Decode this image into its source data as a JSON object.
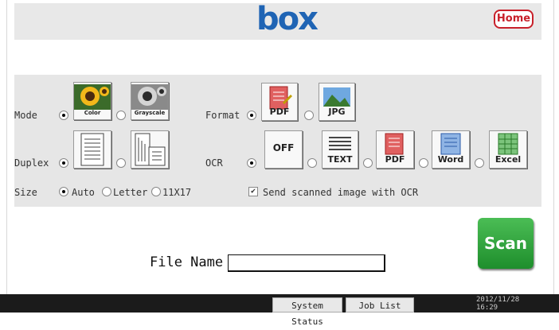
{
  "header": {
    "logo_text": "box",
    "home_label": "Home"
  },
  "mode": {
    "label": "Mode",
    "options": [
      {
        "caption": "Color",
        "selected": true
      },
      {
        "caption": "Grayscale",
        "selected": false
      }
    ]
  },
  "format": {
    "label": "Format",
    "options": [
      {
        "caption": "PDF",
        "selected": true
      },
      {
        "caption": "JPG",
        "selected": false
      }
    ]
  },
  "duplex": {
    "label": "Duplex",
    "options": [
      {
        "icon": "single-sided-page-icon",
        "selected": true
      },
      {
        "icon": "double-sided-pages-icon",
        "selected": false
      }
    ]
  },
  "ocr": {
    "label": "OCR",
    "options": [
      {
        "caption": "OFF",
        "selected": true
      },
      {
        "caption": "TEXT",
        "selected": false
      },
      {
        "caption": "PDF",
        "selected": false
      },
      {
        "caption": "Word",
        "selected": false
      },
      {
        "caption": "Excel",
        "selected": false
      }
    ]
  },
  "size": {
    "label": "Size",
    "options": [
      {
        "label": "Auto",
        "selected": true
      },
      {
        "label": "Letter",
        "selected": false
      },
      {
        "label": "11X17",
        "selected": false
      }
    ]
  },
  "send_with_ocr": {
    "label": "Send scanned image with OCR",
    "checked": true,
    "check_glyph": "✔"
  },
  "file_name": {
    "label": "File Name",
    "value": ""
  },
  "scan_label": "Scan",
  "footer": {
    "system_status_label": "System Status",
    "job_list_label": "Job List",
    "date": "2012/11/28",
    "time": "16:29"
  },
  "colors": {
    "brand_blue": "#1f64b4",
    "home_red": "#c8202a",
    "scan_green": "#2ea03a"
  }
}
